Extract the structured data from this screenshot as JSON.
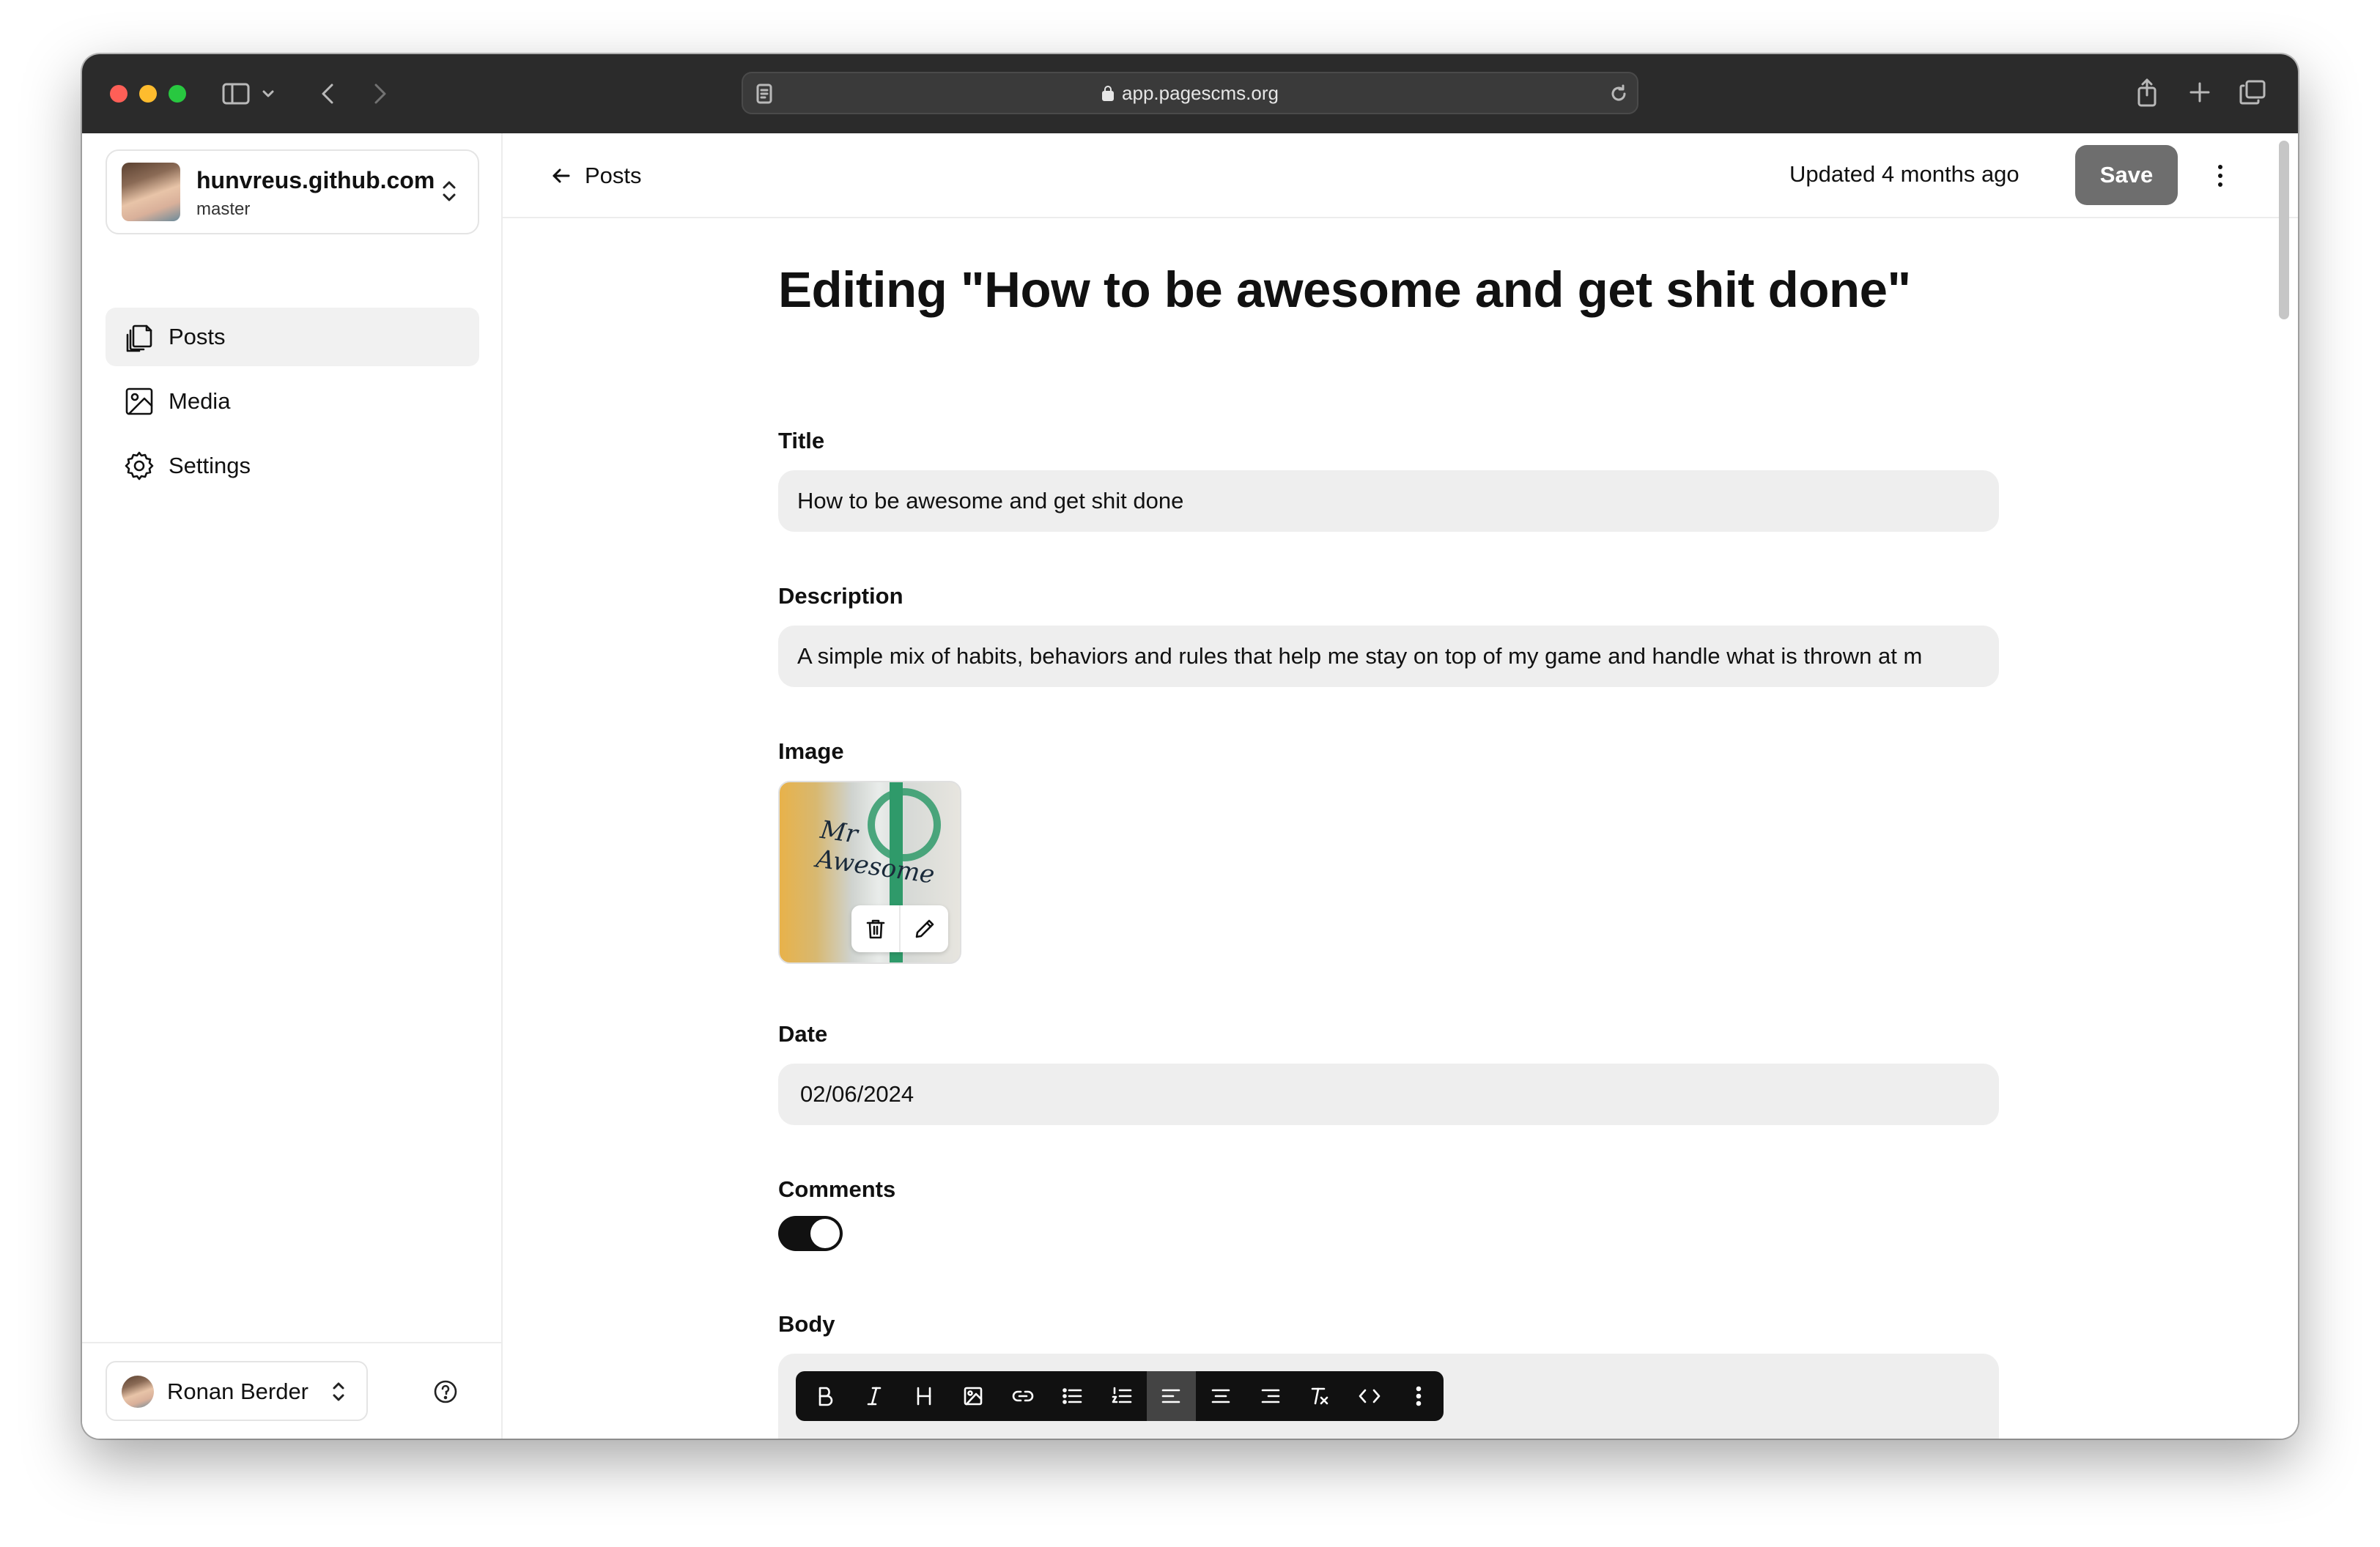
{
  "browser": {
    "url": "app.pagescms.org"
  },
  "sidebar": {
    "repo": {
      "name": "hunvreus.github.com",
      "branch": "master"
    },
    "items": [
      {
        "label": "Posts",
        "icon": "files-icon",
        "active": true
      },
      {
        "label": "Media",
        "icon": "image-icon",
        "active": false
      },
      {
        "label": "Settings",
        "icon": "gear-icon",
        "active": false
      }
    ],
    "user": {
      "name": "Ronan Berder"
    }
  },
  "topbar": {
    "back_label": "Posts",
    "updated": "Updated 4 months ago",
    "save_label": "Save"
  },
  "editor": {
    "heading": "Editing \"How to be awesome and get shit done\"",
    "fields": {
      "title": {
        "label": "Title",
        "value": "How to be awesome and get shit done"
      },
      "description": {
        "label": "Description",
        "value": "A simple mix of habits, behaviors and rules that help me stay on top of my game and handle what is thrown at m"
      },
      "image": {
        "label": "Image",
        "caption": "Mr Awesome"
      },
      "date": {
        "label": "Date",
        "value": "02/06/2024"
      },
      "comments": {
        "label": "Comments",
        "enabled": true
      },
      "body": {
        "label": "Body"
      }
    },
    "toolbar": {
      "buttons": [
        "bold-icon",
        "italic-icon",
        "heading-icon",
        "image-icon",
        "link-icon",
        "bullet-list-icon",
        "ordered-list-icon",
        "align-left-icon",
        "align-center-icon",
        "align-right-icon",
        "clear-format-icon",
        "code-icon",
        "more-icon"
      ],
      "active": "align-left-icon"
    }
  },
  "colors": {
    "chrome": "#2b2b2b",
    "field_bg": "#eeeeee",
    "save_bg": "#6e6e6e",
    "toggle_on": "#111111",
    "accent_green": "#2f9a6a"
  }
}
